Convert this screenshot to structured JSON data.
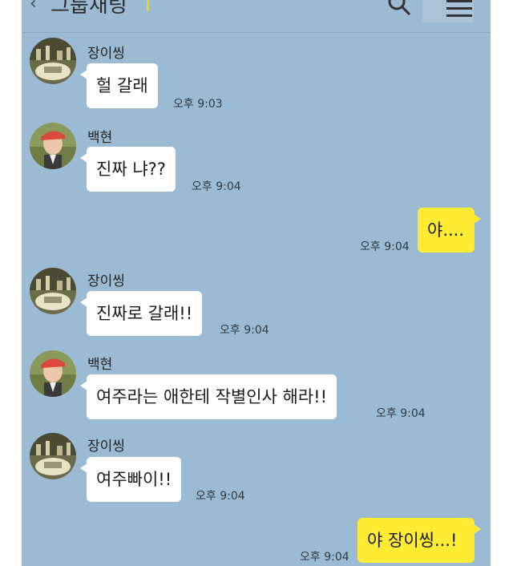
{
  "header": {
    "back_icon": "chevron-left-icon",
    "title": "그룹채팅",
    "search_icon": "search-icon",
    "menu_icon": "hamburger-menu-icon"
  },
  "colors": {
    "chat_background": "#9bbbd4",
    "incoming_bubble": "#ffffff",
    "outgoing_bubble": "#ffeb33"
  },
  "messages": [
    {
      "direction": "in",
      "sender": "장이씽",
      "text": "헐 갈래",
      "time": "오후 9:03"
    },
    {
      "direction": "in",
      "sender": "백현",
      "text": "진짜 냐??",
      "time": "오후 9:04"
    },
    {
      "direction": "out",
      "sender": "",
      "text": "야....",
      "time": "오후 9:04"
    },
    {
      "direction": "in",
      "sender": "장이씽",
      "text": "진짜로 갈래!!",
      "time": "오후 9:04"
    },
    {
      "direction": "in",
      "sender": "백현",
      "text": "여주라는 애한테 작별인사 해라!!",
      "time": "오후 9:04"
    },
    {
      "direction": "in",
      "sender": "장이씽",
      "text": "여주빠이!!",
      "time": "오후 9:04"
    },
    {
      "direction": "out",
      "sender": "",
      "text": "야 장이씽...!",
      "time": "오후 9:04"
    }
  ]
}
